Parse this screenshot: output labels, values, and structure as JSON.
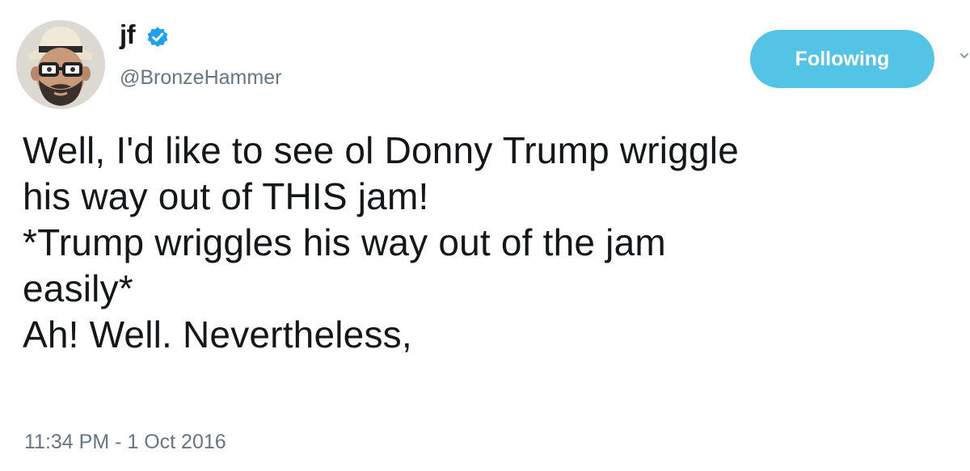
{
  "user": {
    "display_name": "jf",
    "handle": "@BronzeHammer",
    "verified": true
  },
  "follow_button": {
    "label": "Following"
  },
  "tweet": {
    "text": "Well, I'd like to see ol Donny Trump wriggle\nhis way out of THIS jam!\n*Trump wriggles his way out of the jam\neasily*\nAh! Well. Nevertheless,",
    "timestamp": "11:34 PM - 1 Oct 2016"
  },
  "colors": {
    "accent": "#1da1f2",
    "following_button": "#53c4e6",
    "secondary_text": "#657786",
    "primary_text": "#14171a"
  },
  "icons": {
    "verified": "verified-badge-icon",
    "caret": "chevron-down-icon"
  }
}
